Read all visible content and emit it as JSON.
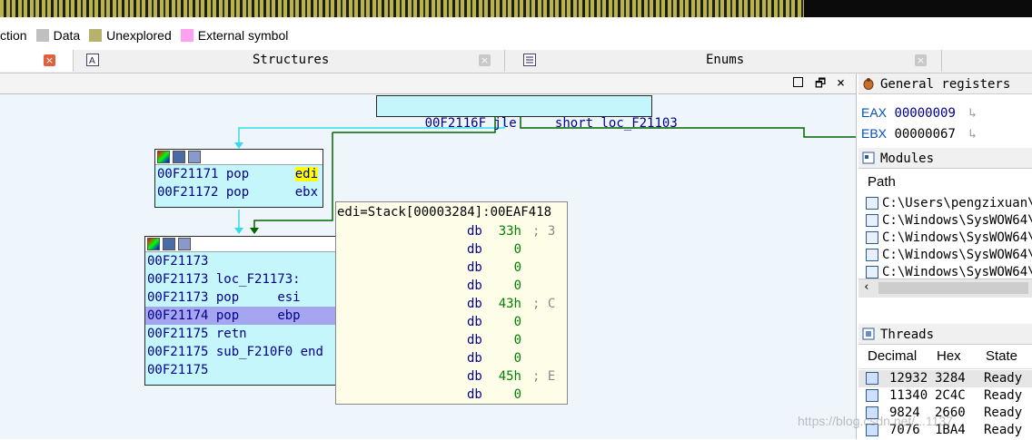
{
  "legend": {
    "items": [
      {
        "label": "ction",
        "color": ""
      },
      {
        "label": "Data",
        "color": "#c0c0c0"
      },
      {
        "label": "Unexplored",
        "color": "#b5b36b"
      },
      {
        "label": "External symbol",
        "color": "#ffa0f0"
      }
    ]
  },
  "tabs": [
    {
      "label": "",
      "close": "×"
    },
    {
      "label": "Structures",
      "close": "×",
      "icon": "structures-icon"
    },
    {
      "label": "Enums",
      "close": "×",
      "icon": "enums-icon"
    }
  ],
  "top_node": {
    "addr": "00F2116F",
    "mnem": "jle",
    "operand": "short loc_F21103"
  },
  "node1": {
    "lines": [
      {
        "addr": "00F21171",
        "mnem": "pop",
        "op": "edi"
      },
      {
        "addr": "00F21172",
        "mnem": "pop",
        "op": "ebx"
      }
    ]
  },
  "node2": {
    "lines": [
      {
        "addr": "00F21173",
        "text": ""
      },
      {
        "addr": "00F21173",
        "text": "loc_F21173:"
      },
      {
        "addr": "00F21173",
        "mnem": "pop",
        "op": "esi"
      },
      {
        "addr": "00F21174",
        "mnem": "pop",
        "op": "ebp"
      },
      {
        "addr": "00F21175",
        "mnem": "retn",
        "op": ""
      },
      {
        "addr": "00F21175",
        "text": "sub_F210F0 end"
      },
      {
        "addr": "00F21175",
        "text": ""
      }
    ]
  },
  "hint": {
    "title": "edi=Stack[00003284]:00EAF418",
    "rows": [
      {
        "dir": "db",
        "val": "33h",
        "cmt": "; 3"
      },
      {
        "dir": "db",
        "val": "0",
        "cmt": ""
      },
      {
        "dir": "db",
        "val": "0",
        "cmt": ""
      },
      {
        "dir": "db",
        "val": "0",
        "cmt": ""
      },
      {
        "dir": "db",
        "val": "43h",
        "cmt": "; C"
      },
      {
        "dir": "db",
        "val": "0",
        "cmt": ""
      },
      {
        "dir": "db",
        "val": "0",
        "cmt": ""
      },
      {
        "dir": "db",
        "val": "0",
        "cmt": ""
      },
      {
        "dir": "db",
        "val": "45h",
        "cmt": "; E"
      },
      {
        "dir": "db",
        "val": "0",
        "cmt": ""
      }
    ]
  },
  "registers": {
    "title": "General registers",
    "items": [
      {
        "name": "EAX",
        "value": "00000009"
      },
      {
        "name": "EBX",
        "value": "00000067"
      }
    ]
  },
  "modules": {
    "title": "Modules",
    "column": "Path",
    "paths": [
      "C:\\Users\\pengzixuan\\",
      "C:\\Windows\\SysWOW64\\",
      "C:\\Windows\\SysWOW64\\",
      "C:\\Windows\\SysWOW64\\",
      "C:\\Windows\\SysWOW64\\"
    ]
  },
  "threads": {
    "title": "Threads",
    "columns": [
      "Decimal",
      "Hex",
      "State"
    ],
    "rows": [
      {
        "dec": "12932",
        "hex": "3284",
        "state": "Ready"
      },
      {
        "dec": "11340",
        "hex": "2C4C",
        "state": "Ready"
      },
      {
        "dec": "9824",
        "hex": "2660",
        "state": "Ready"
      },
      {
        "dec": "7076",
        "hex": "1BA4",
        "state": "Ready"
      }
    ]
  },
  "watermark": "https://blog.csdn.net/...1137",
  "colors": {
    "node_bg": "#c5f6fb",
    "selected_line": "#a6a6f0",
    "highlight": "#ffff00",
    "edge_green": "#006400",
    "edge_cyan": "#33ddee",
    "hint_bg": "#fdfde8"
  }
}
